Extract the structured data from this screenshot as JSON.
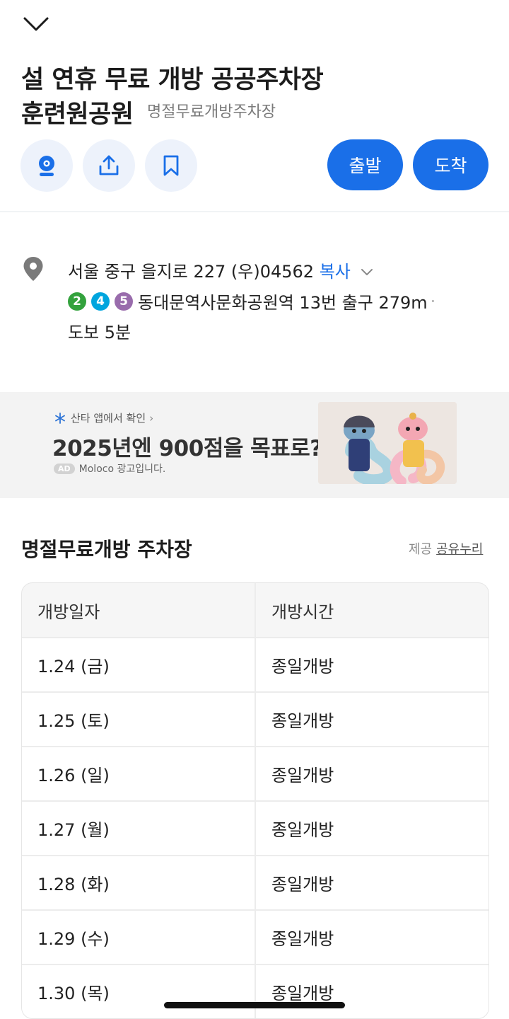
{
  "header": {
    "title_line1": "설 연휴 무료 개방 공공주차장",
    "title_line2": "훈련원공원",
    "category": "명절무료개방주차장"
  },
  "actions": {
    "depart_label": "출발",
    "arrive_label": "도착"
  },
  "address": {
    "text": "서울 중구 을지로 227 (우)04562",
    "copy_label": "복사"
  },
  "subway": {
    "lines": [
      {
        "number": "2",
        "color": "#33a23d"
      },
      {
        "number": "4",
        "color": "#00a5de"
      },
      {
        "number": "5",
        "color": "#996cac"
      }
    ],
    "station_text": "동대문역사문화공원역 13번 출구 279m",
    "separator": "·",
    "walk_text": "도보 5분"
  },
  "ad": {
    "app_text": "산타 앱에서 확인",
    "title": "2025년엔 900점을 목표로?",
    "badge": "AD",
    "note": "Moloco 광고입니다."
  },
  "section": {
    "title": "명절무료개방 주차장",
    "provider_label": "제공",
    "provider_link": "공유누리"
  },
  "table": {
    "headers": [
      "개방일자",
      "개방시간"
    ],
    "rows": [
      [
        "1.24 (금)",
        "종일개방"
      ],
      [
        "1.25 (토)",
        "종일개방"
      ],
      [
        "1.26 (일)",
        "종일개방"
      ],
      [
        "1.27 (월)",
        "종일개방"
      ],
      [
        "1.28 (화)",
        "종일개방"
      ],
      [
        "1.29 (수)",
        "종일개방"
      ],
      [
        "1.30 (목)",
        "종일개방"
      ]
    ]
  },
  "colors": {
    "accent": "#1a6fe8",
    "icon_button_bg": "#edf2fb"
  },
  "icons": [
    "chevron-down-icon",
    "cctv-icon",
    "share-icon",
    "bookmark-icon",
    "location-pin-icon",
    "chevron-down-small-icon",
    "santa-snowflake-icon"
  ]
}
